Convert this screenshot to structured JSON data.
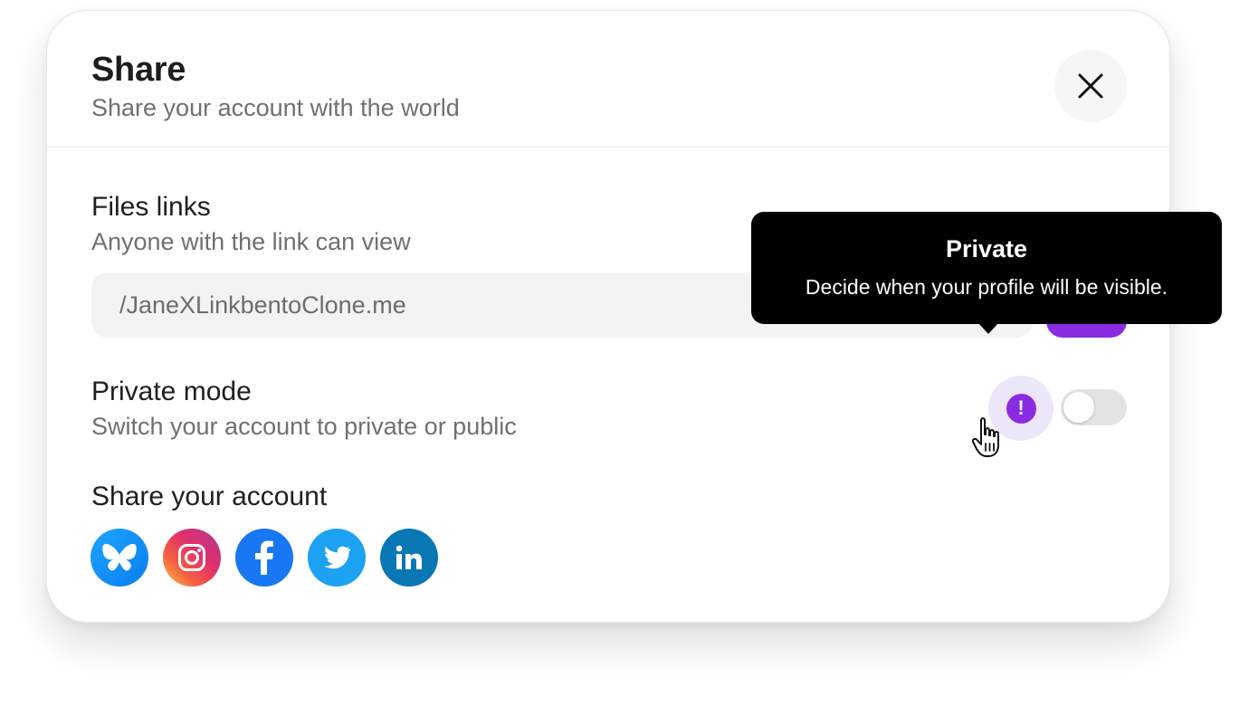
{
  "header": {
    "title": "Share",
    "subtitle": "Share your account with the world",
    "close_icon": "close-icon"
  },
  "files_links": {
    "title": "Files links",
    "subtitle": "Anyone with the link can view",
    "link_value": "/JaneXLinkbentoClone.me",
    "copy_button_color": "#8a2be2"
  },
  "private_mode": {
    "title": "Private mode",
    "subtitle": "Switch your account to private or public",
    "info_icon": "exclamation-icon",
    "toggle_on": false
  },
  "share_account": {
    "title": "Share your account",
    "socials": [
      {
        "name": "bluesky",
        "icon": "butterfly-icon",
        "color": "#1185fe"
      },
      {
        "name": "instagram",
        "icon": "instagram-icon",
        "color": "#e1306c"
      },
      {
        "name": "facebook",
        "icon": "facebook-icon",
        "color": "#1877f2"
      },
      {
        "name": "twitter",
        "icon": "bird-icon",
        "color": "#1da1f2"
      },
      {
        "name": "linkedin",
        "icon": "linkedin-icon",
        "color": "#0a77b5"
      }
    ]
  },
  "tooltip": {
    "title": "Private",
    "text": "Decide when your profile will be visible."
  },
  "colors": {
    "accent": "#8a2be2",
    "accent_light": "#ece6fb",
    "muted_text": "#6f6f74"
  }
}
